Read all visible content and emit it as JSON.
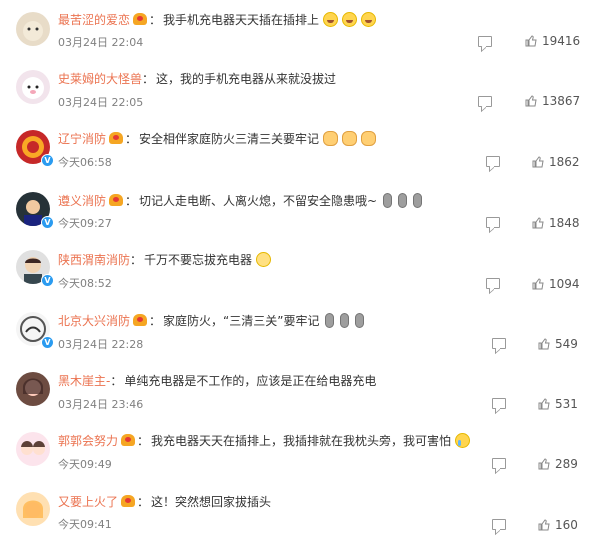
{
  "comments": [
    {
      "user": "最苦涩的爱恋",
      "medal": true,
      "text": "我手机充电器天天插在插排上",
      "emoji_count": 3,
      "emoji_type": "laugh",
      "time": "03月24日 22:04",
      "likes": "19416"
    },
    {
      "user": "史莱姆的大怪兽",
      "medal": false,
      "text": "这，我的手机充电器从来就没拔过",
      "emoji_count": 0,
      "emoji_type": "",
      "time": "03月24日 22:05",
      "likes": "13867"
    },
    {
      "user": "辽宁消防",
      "medal": true,
      "text": "安全相伴家庭防火三清三关要牢记",
      "emoji_count": 3,
      "emoji_type": "hand",
      "time": "今天06:58",
      "likes": "1862"
    },
    {
      "user": "遵义消防",
      "medal": true,
      "text": "切记人走电断、人离火熄，不留安全隐患哦~",
      "emoji_count": 3,
      "emoji_type": "mic",
      "time": "今天09:27",
      "likes": "1848"
    },
    {
      "user": "陕西渭南消防",
      "medal": false,
      "text": "千万不要忘拔充电器",
      "emoji_count": 1,
      "emoji_type": "doh",
      "time": "今天08:52",
      "likes": "1094"
    },
    {
      "user": "北京大兴消防",
      "medal": true,
      "text": "家庭防火，“三清三关”要牢记",
      "emoji_count": 3,
      "emoji_type": "mic",
      "time": "03月24日 22:28",
      "likes": "549"
    },
    {
      "user": "黑木崖主-",
      "medal": false,
      "text": "单纯充电器是不工作的，应该是正在给电器充电",
      "emoji_count": 0,
      "emoji_type": "",
      "time": "03月24日 23:46",
      "likes": "531"
    },
    {
      "user": "郭郭会努力",
      "medal": true,
      "text": "我充电器天天在插排上，我插排就在我枕头旁，我可害怕",
      "emoji_count": 1,
      "emoji_type": "cry",
      "time": "今天09:49",
      "likes": "289"
    },
    {
      "user": "又要上火了",
      "medal": true,
      "text": "这！突然想回家拔插头",
      "emoji_count": 0,
      "emoji_type": "",
      "time": "今天09:41",
      "likes": "160"
    }
  ],
  "colors": {
    "username": "#eb7350",
    "text": "#333333",
    "meta": "#808080"
  },
  "icons": {
    "reply": "comment-icon",
    "like": "thumbs-up-icon",
    "medal": "fan-medal-icon",
    "verified": "verified-badge-icon"
  }
}
